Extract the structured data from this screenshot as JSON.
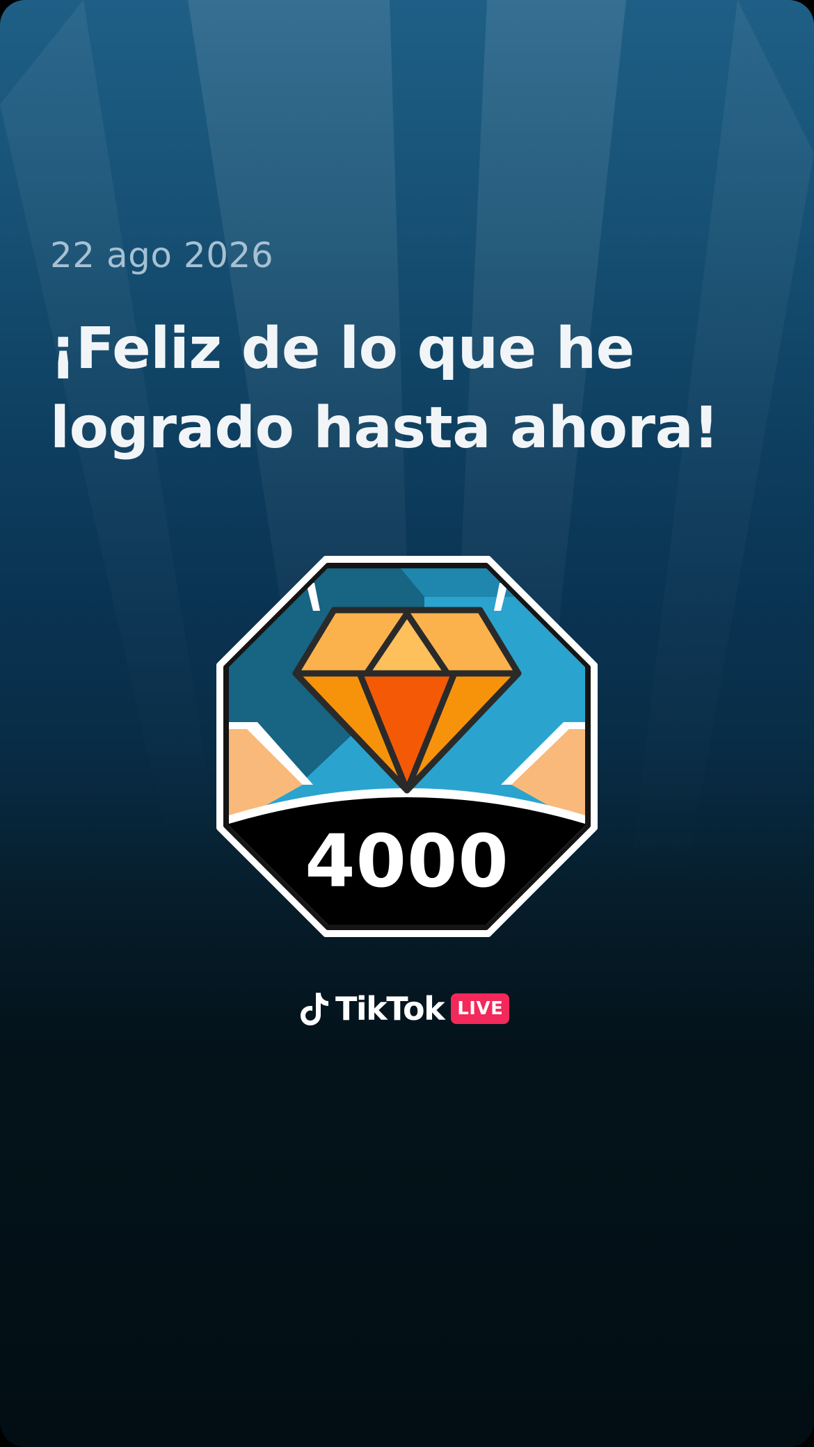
{
  "card": {
    "date": "22 ago 2026",
    "headline_line1": "¡Feliz de lo que he",
    "headline_line2": "logrado hasta ahora!"
  },
  "badge": {
    "icon": "diamond-icon",
    "value": "4000"
  },
  "brand": {
    "name": "TikTok",
    "tag": "LIVE",
    "icon": "tiktok-logo-icon"
  },
  "colors": {
    "background_top": "#1f5f86",
    "background_bottom": "#020e13",
    "live_tag": "#f2295a",
    "diamond_orange": "#f7930a",
    "diamond_center": "#f45a06",
    "diamond_light": "#fbb24d",
    "badge_blue": "#2aa4cf",
    "badge_peach": "#f9b97a"
  }
}
